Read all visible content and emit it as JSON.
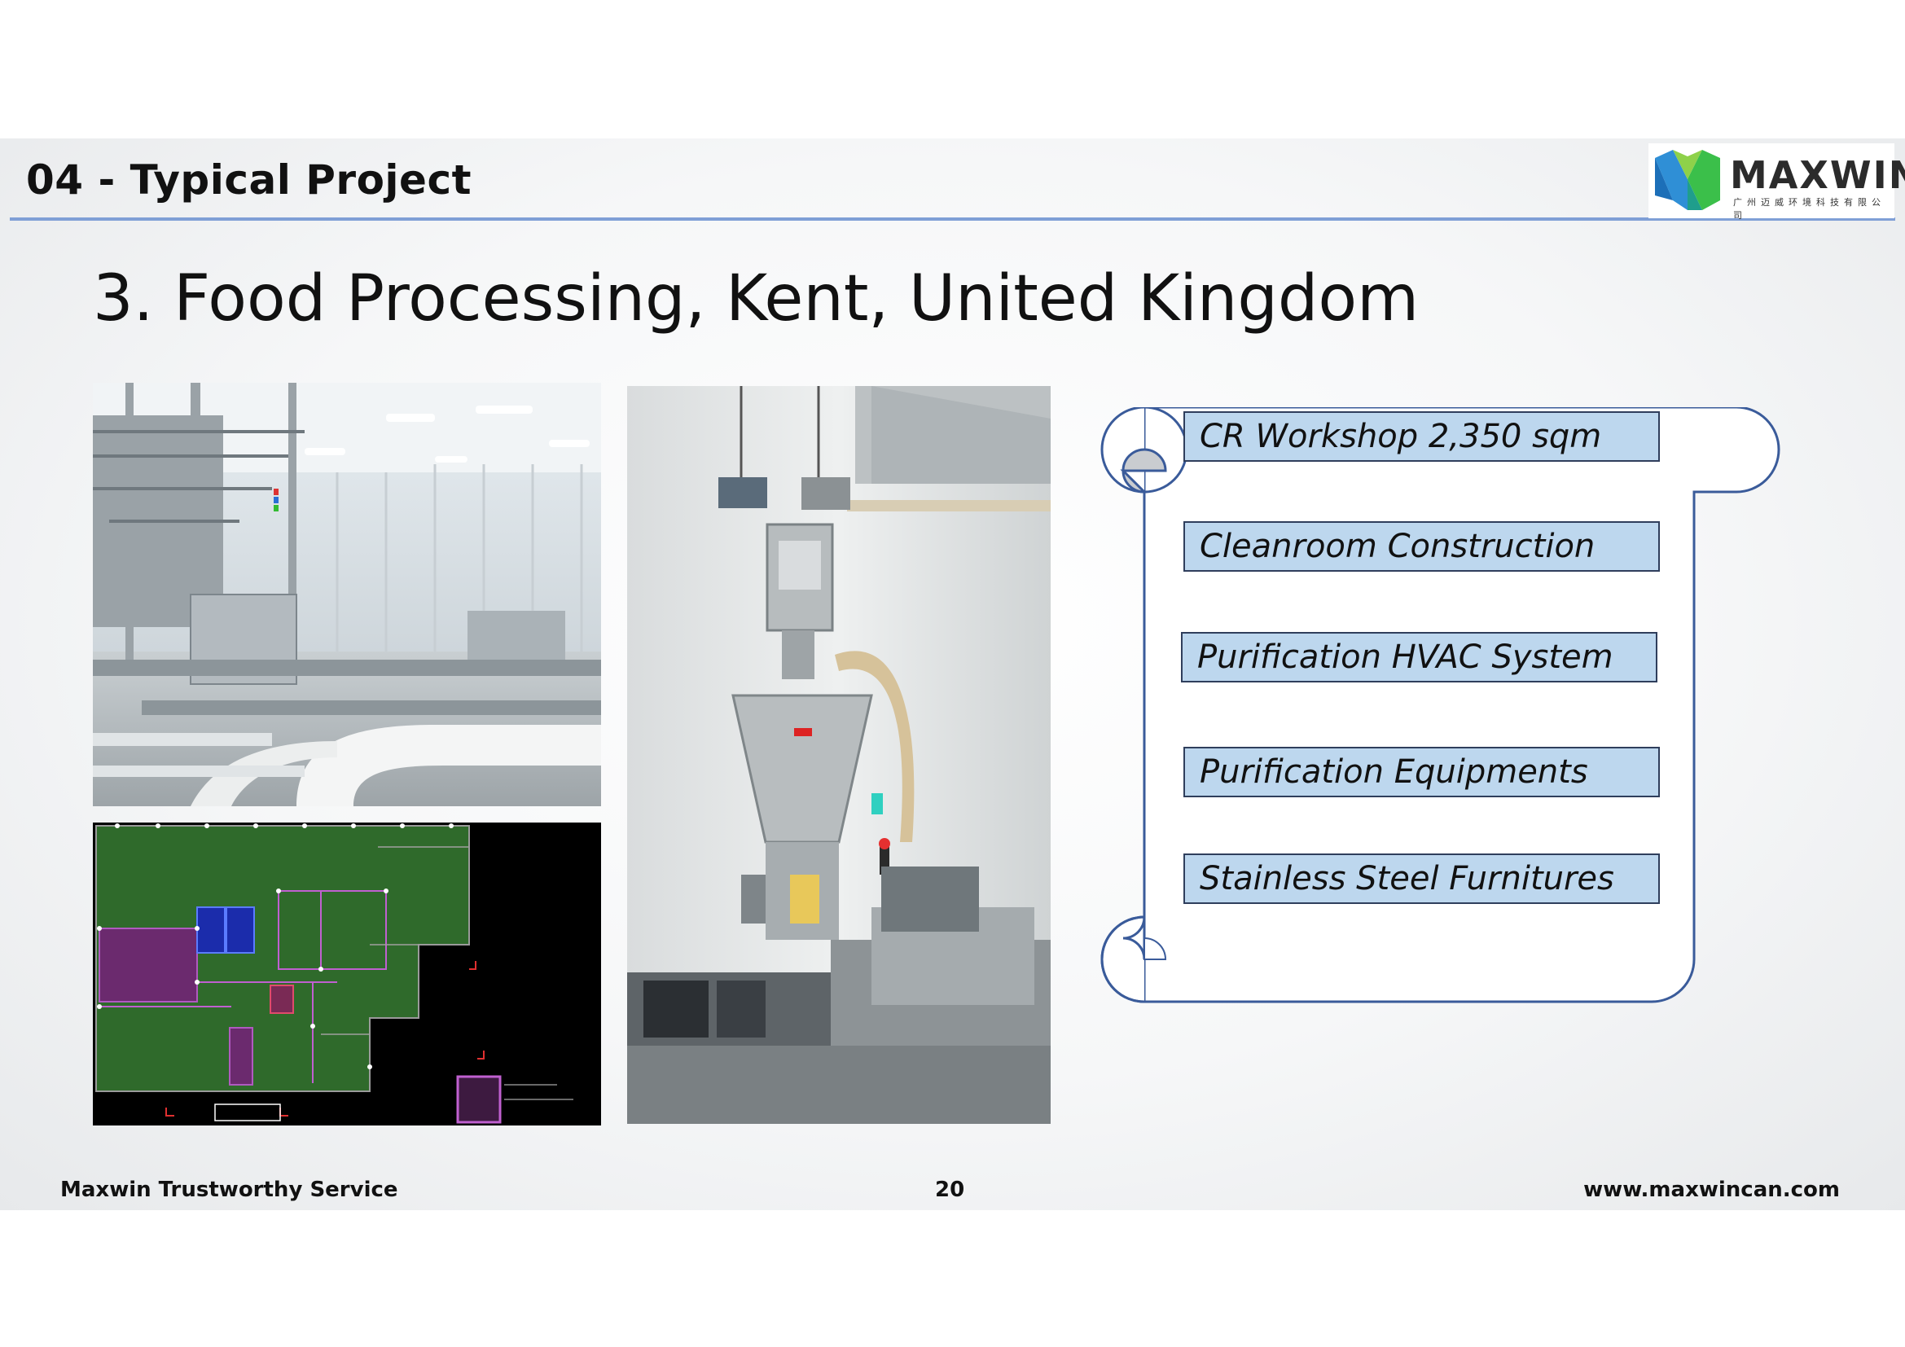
{
  "header": {
    "section_title": "04 - Typical Project",
    "logo_text": "MAXWIN",
    "logo_subtext": "广州迈威环境科技有限公司"
  },
  "slide": {
    "title": "3. Food Processing, Kent, United Kingdom"
  },
  "photos": [
    {
      "name": "production-line-photo",
      "subject": "conveyor-production-line"
    },
    {
      "name": "floor-plan-drawing",
      "subject": "cad-floor-plan"
    },
    {
      "name": "processing-machine-photo",
      "subject": "stainless-machine"
    }
  ],
  "scope": {
    "items": [
      "CR Workshop 2,350 sqm",
      "Cleanroom Construction",
      "Purification HVAC System",
      "Purification Equipments",
      "Stainless Steel Furnitures"
    ]
  },
  "footer": {
    "left": "Maxwin Trustworthy Service",
    "page": "20",
    "right": "www.maxwincan.com"
  },
  "colors": {
    "header_rule": "#7f9fd6",
    "scope_fill": "#bdd7ee",
    "scroll_stroke": "#3a5b9a",
    "logo_green": "#3bbf4a",
    "logo_blue": "#2f8fd6"
  }
}
